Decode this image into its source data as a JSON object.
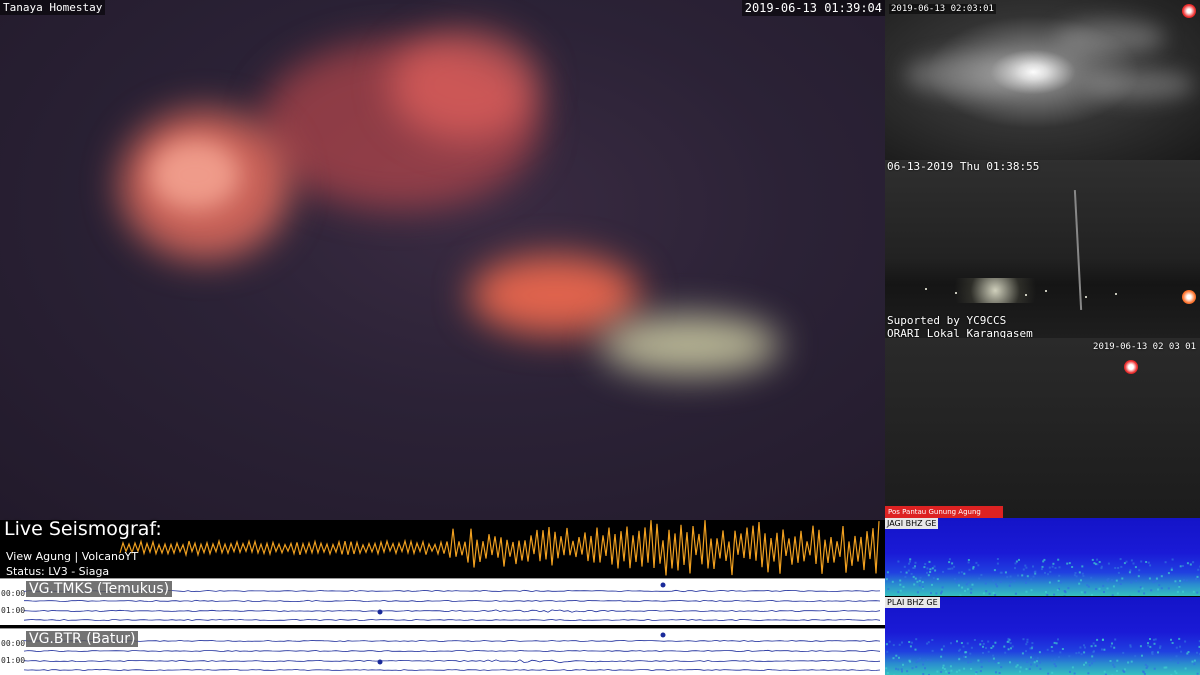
{
  "main_feed": {
    "camera_name": "Tanaya Homestay",
    "timestamp": "2019-06-13 01:39:04"
  },
  "seismograph": {
    "title": "Live Seismograf:",
    "view_text": "View Agung | VolcanoYT",
    "status_text": "Status: LV3 - Siaga",
    "stations": [
      {
        "label": "VG.TMKS (Temukus)",
        "times": [
          "00:00",
          "01:00"
        ]
      },
      {
        "label": "VG.BTR (Batur)",
        "times": [
          "00:00",
          "01:00"
        ]
      }
    ]
  },
  "side_cams": {
    "cam1_timestamp": "2019-06-13 02:03:01",
    "cam2_timestamp": "06-13-2019 Thu 01:38:55",
    "cam2_credit_line1": "Suported by YC9CCS",
    "cam2_credit_line2": "ORARI Lokal Karangasem",
    "cam3_timestamp": "2019-06-13 02 03 01",
    "cam3_banner": "Pos Pantau Gunung Agung"
  },
  "spectrograms": [
    {
      "label": "JAGI BHZ GE"
    },
    {
      "label": "PLAI BHZ GE"
    }
  ],
  "colors": {
    "wave_orange": "#f0a020",
    "helicorder_trace": "#1a2a9a",
    "banner_red": "#dd2222"
  }
}
